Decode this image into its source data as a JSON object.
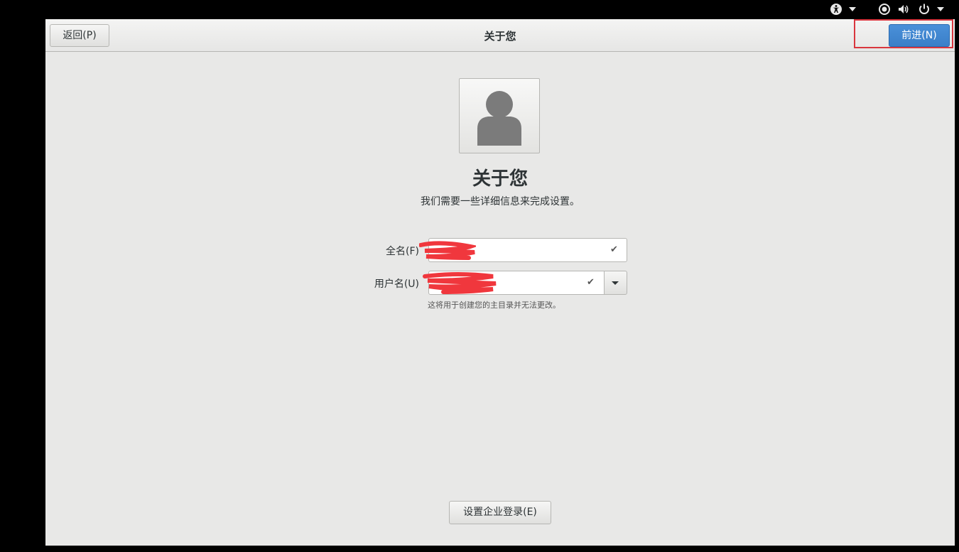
{
  "system_bar": {
    "icons": [
      "accessibility-icon",
      "network-icon",
      "volume-icon",
      "power-icon"
    ]
  },
  "header": {
    "title": "关于您",
    "back_label": "返回(P)",
    "next_label": "前进(N)"
  },
  "main": {
    "heading": "关于您",
    "subtitle": "我们需要一些详细信息来完成设置。",
    "fullname_label": "全名(F)",
    "username_label": "用户名(U)",
    "username_hint": "这将用于创建您的主目录并无法更改。",
    "enterprise_login_label": "设置企业登录(E)"
  },
  "colors": {
    "accent": "#4a90d9",
    "highlight_border": "#d9363e",
    "redaction": "#f0373d"
  }
}
